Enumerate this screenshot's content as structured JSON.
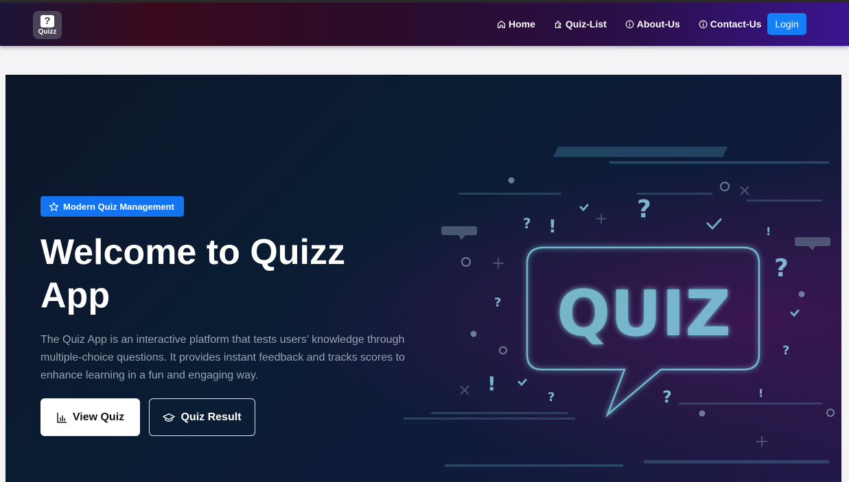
{
  "navbar": {
    "logo_text": "Quizz",
    "logo_symbol": "?",
    "links": [
      {
        "label": "Home",
        "icon": "home-icon"
      },
      {
        "label": "Quiz-List",
        "icon": "puzzle-icon"
      },
      {
        "label": "About-Us",
        "icon": "info-icon"
      },
      {
        "label": "Contact-Us",
        "icon": "info-icon"
      }
    ],
    "login_label": "Login"
  },
  "hero": {
    "badge": "Modern Quiz Management",
    "title": "Welcome to Quizz App",
    "description": "The Quiz App is an interactive platform that tests users’ knowledge through multiple-choice questions. It provides instant feedback and tracks scores to enhance learning in a fun and engaging way.",
    "view_quiz_label": "View Quiz",
    "quiz_result_label": "Quiz Result",
    "art_text": "QUIZ"
  },
  "colors": {
    "primary": "#1374f2",
    "hero_bg": "#0d1a30",
    "art_glow": "#7fd3e6"
  }
}
